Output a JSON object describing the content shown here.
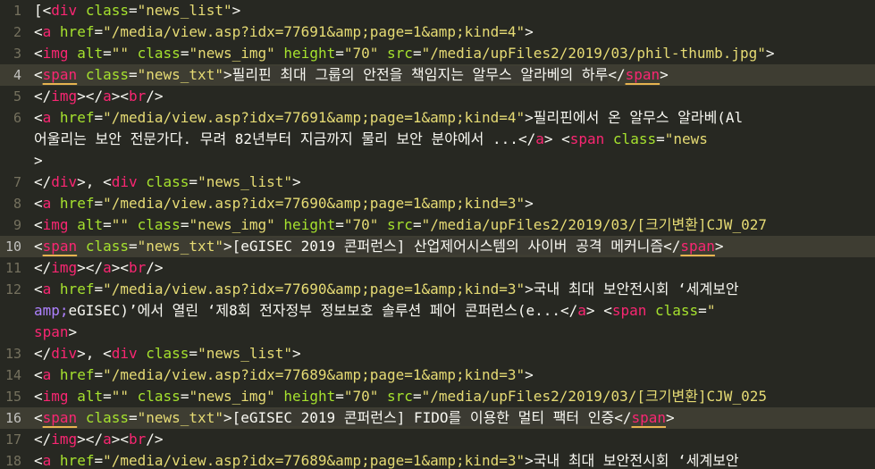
{
  "editor": {
    "colors": {
      "background": "#272822",
      "gutter": "#75715e",
      "plain": "#f8f8f2",
      "tag": "#f92672",
      "attribute": "#a6e22e",
      "string": "#e6db74",
      "entity": "#ae81ff",
      "bracket_underline": "#e6b450"
    },
    "active_line_numbers": [
      "4",
      "10",
      "16"
    ],
    "lines": [
      {
        "num": "1",
        "tokens": [
          {
            "c": "p",
            "t": "[<"
          },
          {
            "c": "tag",
            "t": "div"
          },
          {
            "c": "p",
            "t": " "
          },
          {
            "c": "at",
            "t": "class"
          },
          {
            "c": "p",
            "t": "="
          },
          {
            "c": "s",
            "t": "\"news_list\""
          },
          {
            "c": "p",
            "t": ">"
          }
        ]
      },
      {
        "num": "2",
        "tokens": [
          {
            "c": "p",
            "t": "<"
          },
          {
            "c": "tag",
            "t": "a"
          },
          {
            "c": "p",
            "t": " "
          },
          {
            "c": "at",
            "t": "href"
          },
          {
            "c": "p",
            "t": "="
          },
          {
            "c": "s",
            "t": "\"/media/view.asp?idx=77691&amp;page=1&amp;kind=4\""
          },
          {
            "c": "p",
            "t": ">"
          }
        ]
      },
      {
        "num": "3",
        "tokens": [
          {
            "c": "p",
            "t": "<"
          },
          {
            "c": "tag",
            "t": "img"
          },
          {
            "c": "p",
            "t": " "
          },
          {
            "c": "at",
            "t": "alt"
          },
          {
            "c": "p",
            "t": "="
          },
          {
            "c": "s",
            "t": "\"\""
          },
          {
            "c": "p",
            "t": " "
          },
          {
            "c": "at",
            "t": "class"
          },
          {
            "c": "p",
            "t": "="
          },
          {
            "c": "s",
            "t": "\"news_img\""
          },
          {
            "c": "p",
            "t": " "
          },
          {
            "c": "at",
            "t": "height"
          },
          {
            "c": "p",
            "t": "="
          },
          {
            "c": "s",
            "t": "\"70\""
          },
          {
            "c": "p",
            "t": " "
          },
          {
            "c": "at",
            "t": "src"
          },
          {
            "c": "p",
            "t": "="
          },
          {
            "c": "s",
            "t": "\"/media/upFiles2/2019/03/phil-thumb.jpg\""
          },
          {
            "c": "p",
            "t": ">"
          }
        ]
      },
      {
        "num": "4",
        "active": true,
        "tokens": [
          {
            "c": "p",
            "t": "<"
          },
          {
            "c": "tag",
            "t": "span",
            "u": true
          },
          {
            "c": "p",
            "t": " "
          },
          {
            "c": "at",
            "t": "class"
          },
          {
            "c": "p",
            "t": "="
          },
          {
            "c": "s",
            "t": "\"news_txt\""
          },
          {
            "c": "p",
            "t": ">"
          },
          {
            "c": "tx",
            "t": "필리핀 최대 그룹의 안전을 책임지는 알무스 알라베의 하루"
          },
          {
            "c": "p",
            "t": "</"
          },
          {
            "c": "tag",
            "t": "span",
            "u": true
          },
          {
            "c": "p",
            "t": ">"
          }
        ]
      },
      {
        "num": "5",
        "tokens": [
          {
            "c": "p",
            "t": "</"
          },
          {
            "c": "tag",
            "t": "img"
          },
          {
            "c": "p",
            "t": "></"
          },
          {
            "c": "tag",
            "t": "a"
          },
          {
            "c": "p",
            "t": "><"
          },
          {
            "c": "tag",
            "t": "br"
          },
          {
            "c": "p",
            "t": "/>"
          }
        ]
      },
      {
        "num": "6",
        "tokens": [
          {
            "c": "p",
            "t": "<"
          },
          {
            "c": "tag",
            "t": "a"
          },
          {
            "c": "p",
            "t": " "
          },
          {
            "c": "at",
            "t": "href"
          },
          {
            "c": "p",
            "t": "="
          },
          {
            "c": "s",
            "t": "\"/media/view.asp?idx=77691&amp;page=1&amp;kind=4\""
          },
          {
            "c": "p",
            "t": ">"
          },
          {
            "c": "tx",
            "t": "필리핀에서 온 알무스 알라베(Al"
          }
        ]
      },
      {
        "num": "",
        "tokens": [
          {
            "c": "tx",
            "t": "어울리는 보안 전문가다. 무려 82년부터 지금까지 물리 보안 분야에서 ..."
          },
          {
            "c": "p",
            "t": "</"
          },
          {
            "c": "tag",
            "t": "a"
          },
          {
            "c": "p",
            "t": "> <"
          },
          {
            "c": "tag",
            "t": "span"
          },
          {
            "c": "p",
            "t": " "
          },
          {
            "c": "at",
            "t": "class"
          },
          {
            "c": "p",
            "t": "="
          },
          {
            "c": "s",
            "t": "\"news"
          }
        ]
      },
      {
        "num": "",
        "tokens": [
          {
            "c": "p",
            "t": ">"
          }
        ]
      },
      {
        "num": "7",
        "tokens": [
          {
            "c": "p",
            "t": "</"
          },
          {
            "c": "tag",
            "t": "div"
          },
          {
            "c": "p",
            "t": ">, <"
          },
          {
            "c": "tag",
            "t": "div"
          },
          {
            "c": "p",
            "t": " "
          },
          {
            "c": "at",
            "t": "class"
          },
          {
            "c": "p",
            "t": "="
          },
          {
            "c": "s",
            "t": "\"news_list\""
          },
          {
            "c": "p",
            "t": ">"
          }
        ]
      },
      {
        "num": "8",
        "tokens": [
          {
            "c": "p",
            "t": "<"
          },
          {
            "c": "tag",
            "t": "a"
          },
          {
            "c": "p",
            "t": " "
          },
          {
            "c": "at",
            "t": "href"
          },
          {
            "c": "p",
            "t": "="
          },
          {
            "c": "s",
            "t": "\"/media/view.asp?idx=77690&amp;page=1&amp;kind=3\""
          },
          {
            "c": "p",
            "t": ">"
          }
        ]
      },
      {
        "num": "9",
        "tokens": [
          {
            "c": "p",
            "t": "<"
          },
          {
            "c": "tag",
            "t": "img"
          },
          {
            "c": "p",
            "t": " "
          },
          {
            "c": "at",
            "t": "alt"
          },
          {
            "c": "p",
            "t": "="
          },
          {
            "c": "s",
            "t": "\"\""
          },
          {
            "c": "p",
            "t": " "
          },
          {
            "c": "at",
            "t": "class"
          },
          {
            "c": "p",
            "t": "="
          },
          {
            "c": "s",
            "t": "\"news_img\""
          },
          {
            "c": "p",
            "t": " "
          },
          {
            "c": "at",
            "t": "height"
          },
          {
            "c": "p",
            "t": "="
          },
          {
            "c": "s",
            "t": "\"70\""
          },
          {
            "c": "p",
            "t": " "
          },
          {
            "c": "at",
            "t": "src"
          },
          {
            "c": "p",
            "t": "="
          },
          {
            "c": "s",
            "t": "\"/media/upFiles2/2019/03/[크기변환]CJW_027"
          }
        ]
      },
      {
        "num": "10",
        "active": true,
        "tokens": [
          {
            "c": "p",
            "t": "<"
          },
          {
            "c": "tag",
            "t": "span",
            "u": true
          },
          {
            "c": "p",
            "t": " "
          },
          {
            "c": "at",
            "t": "class"
          },
          {
            "c": "p",
            "t": "="
          },
          {
            "c": "s",
            "t": "\"news_txt\""
          },
          {
            "c": "p",
            "t": ">"
          },
          {
            "c": "tx",
            "t": "[eGISEC 2019 콘퍼런스] 산업제어시스템의 사이버 공격 메커니즘"
          },
          {
            "c": "p",
            "t": "</"
          },
          {
            "c": "tag",
            "t": "span",
            "u": true
          },
          {
            "c": "p",
            "t": ">"
          }
        ]
      },
      {
        "num": "11",
        "tokens": [
          {
            "c": "p",
            "t": "</"
          },
          {
            "c": "tag",
            "t": "img"
          },
          {
            "c": "p",
            "t": "></"
          },
          {
            "c": "tag",
            "t": "a"
          },
          {
            "c": "p",
            "t": "><"
          },
          {
            "c": "tag",
            "t": "br"
          },
          {
            "c": "p",
            "t": "/>"
          }
        ]
      },
      {
        "num": "12",
        "tokens": [
          {
            "c": "p",
            "t": "<"
          },
          {
            "c": "tag",
            "t": "a"
          },
          {
            "c": "p",
            "t": " "
          },
          {
            "c": "at",
            "t": "href"
          },
          {
            "c": "p",
            "t": "="
          },
          {
            "c": "s",
            "t": "\"/media/view.asp?idx=77690&amp;page=1&amp;kind=3\""
          },
          {
            "c": "p",
            "t": ">"
          },
          {
            "c": "tx",
            "t": "국내 최대 보안전시회 ‘세계보안"
          }
        ]
      },
      {
        "num": "",
        "tokens": [
          {
            "c": "en",
            "t": "amp;"
          },
          {
            "c": "tx",
            "t": "eGISEC)’에서 열린 ‘제8회 전자정부 정보보호 솔루션 페어 콘퍼런스(e..."
          },
          {
            "c": "p",
            "t": "</"
          },
          {
            "c": "tag",
            "t": "a"
          },
          {
            "c": "p",
            "t": "> <"
          },
          {
            "c": "tag",
            "t": "span"
          },
          {
            "c": "p",
            "t": " "
          },
          {
            "c": "at",
            "t": "class"
          },
          {
            "c": "p",
            "t": "="
          },
          {
            "c": "s",
            "t": "\""
          }
        ]
      },
      {
        "num": "",
        "tokens": [
          {
            "c": "tag",
            "t": "span"
          },
          {
            "c": "p",
            "t": ">"
          }
        ]
      },
      {
        "num": "13",
        "tokens": [
          {
            "c": "p",
            "t": "</"
          },
          {
            "c": "tag",
            "t": "div"
          },
          {
            "c": "p",
            "t": ">, <"
          },
          {
            "c": "tag",
            "t": "div"
          },
          {
            "c": "p",
            "t": " "
          },
          {
            "c": "at",
            "t": "class"
          },
          {
            "c": "p",
            "t": "="
          },
          {
            "c": "s",
            "t": "\"news_list\""
          },
          {
            "c": "p",
            "t": ">"
          }
        ]
      },
      {
        "num": "14",
        "tokens": [
          {
            "c": "p",
            "t": "<"
          },
          {
            "c": "tag",
            "t": "a"
          },
          {
            "c": "p",
            "t": " "
          },
          {
            "c": "at",
            "t": "href"
          },
          {
            "c": "p",
            "t": "="
          },
          {
            "c": "s",
            "t": "\"/media/view.asp?idx=77689&amp;page=1&amp;kind=3\""
          },
          {
            "c": "p",
            "t": ">"
          }
        ]
      },
      {
        "num": "15",
        "tokens": [
          {
            "c": "p",
            "t": "<"
          },
          {
            "c": "tag",
            "t": "img"
          },
          {
            "c": "p",
            "t": " "
          },
          {
            "c": "at",
            "t": "alt"
          },
          {
            "c": "p",
            "t": "="
          },
          {
            "c": "s",
            "t": "\"\""
          },
          {
            "c": "p",
            "t": " "
          },
          {
            "c": "at",
            "t": "class"
          },
          {
            "c": "p",
            "t": "="
          },
          {
            "c": "s",
            "t": "\"news_img\""
          },
          {
            "c": "p",
            "t": " "
          },
          {
            "c": "at",
            "t": "height"
          },
          {
            "c": "p",
            "t": "="
          },
          {
            "c": "s",
            "t": "\"70\""
          },
          {
            "c": "p",
            "t": " "
          },
          {
            "c": "at",
            "t": "src"
          },
          {
            "c": "p",
            "t": "="
          },
          {
            "c": "s",
            "t": "\"/media/upFiles2/2019/03/[크기변환]CJW_025"
          }
        ]
      },
      {
        "num": "16",
        "active": true,
        "tokens": [
          {
            "c": "p",
            "t": "<"
          },
          {
            "c": "tag",
            "t": "span",
            "u": true
          },
          {
            "c": "p",
            "t": " "
          },
          {
            "c": "at",
            "t": "class"
          },
          {
            "c": "p",
            "t": "="
          },
          {
            "c": "s",
            "t": "\"news_txt\""
          },
          {
            "c": "p",
            "t": ">"
          },
          {
            "c": "tx",
            "t": "[eGISEC 2019 콘퍼런스] FIDO를 이용한 멀티 팩터 인증"
          },
          {
            "c": "p",
            "t": "</"
          },
          {
            "c": "tag",
            "t": "span",
            "u": true
          },
          {
            "c": "p",
            "t": ">"
          }
        ]
      },
      {
        "num": "17",
        "tokens": [
          {
            "c": "p",
            "t": "</"
          },
          {
            "c": "tag",
            "t": "img"
          },
          {
            "c": "p",
            "t": "></"
          },
          {
            "c": "tag",
            "t": "a"
          },
          {
            "c": "p",
            "t": "><"
          },
          {
            "c": "tag",
            "t": "br"
          },
          {
            "c": "p",
            "t": "/>"
          }
        ]
      },
      {
        "num": "18",
        "tokens": [
          {
            "c": "p",
            "t": "<"
          },
          {
            "c": "tag",
            "t": "a"
          },
          {
            "c": "p",
            "t": " "
          },
          {
            "c": "at",
            "t": "href"
          },
          {
            "c": "p",
            "t": "="
          },
          {
            "c": "s",
            "t": "\"/media/view.asp?idx=77689&amp;page=1&amp;kind=3\""
          },
          {
            "c": "p",
            "t": ">"
          },
          {
            "c": "tx",
            "t": "국내 최대 보안전시회 ‘세계보안"
          }
        ]
      }
    ]
  }
}
